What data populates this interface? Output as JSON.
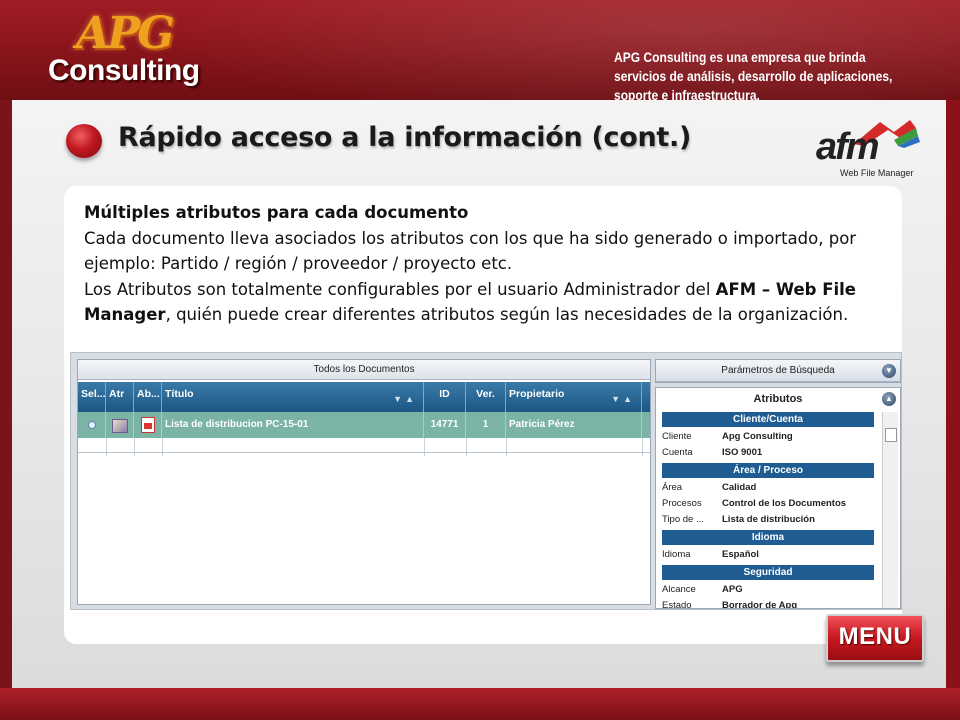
{
  "header": {
    "logo_apg": "APG",
    "logo_consulting": "Consulting",
    "tagline": "APG Consulting es una empresa que brinda servicios de análisis, desarrollo de aplicaciones, soporte e infraestructura."
  },
  "slide": {
    "title": "Rápido acceso a la información (cont.)",
    "afm_logo": "afm",
    "afm_sub": "Web File Manager",
    "heading": "Múltiples atributos para cada documento",
    "para1": "Cada documento lleva asociados los atributos con los que ha sido generado o importado, por ejemplo: Partido / región / proveedor / proyecto etc.",
    "para2_a": "Los Atributos son totalmente configurables por el usuario Administrador del ",
    "para2_b": "AFM – Web File Manager",
    "para2_c": ", quién puede crear diferentes atributos según las necesidades de la organización."
  },
  "app": {
    "grid_title": "Todos los Documentos",
    "columns": [
      "Sel...",
      "Atr",
      "Ab...",
      "Título",
      "ID",
      "Ver.",
      "Propietario"
    ],
    "row": {
      "title": "Lista de distribucion PC-15-01",
      "id": "14771",
      "ver": "1",
      "owner": "Patricia Pérez"
    },
    "search_title": "Parámetros de Búsqueda",
    "attr_title": "Atributos",
    "sections": [
      {
        "name": "Cliente/Cuenta",
        "fields": [
          {
            "k": "Cliente",
            "v": "Apg Consulting"
          },
          {
            "k": "Cuenta",
            "v": "ISO 9001"
          }
        ]
      },
      {
        "name": "Área / Proceso",
        "fields": [
          {
            "k": "Área",
            "v": "Calidad"
          },
          {
            "k": "Procesos",
            "v": "Control de los Documentos"
          },
          {
            "k": "Tipo de ...",
            "v": "Lista de distribución"
          }
        ]
      },
      {
        "name": "Idioma",
        "fields": [
          {
            "k": "Idioma",
            "v": "Español"
          }
        ]
      },
      {
        "name": "Seguridad",
        "fields": [
          {
            "k": "Alcance",
            "v": "APG"
          },
          {
            "k": "Estado",
            "v": "Borrador de Apg"
          }
        ]
      }
    ]
  },
  "nav": {
    "menu_label": "MENU"
  },
  "colors": {
    "brand_red": "#a01c24",
    "grid_header": "#1d5784",
    "row_selected": "#7bb3a5",
    "section": "#1e5c92"
  }
}
